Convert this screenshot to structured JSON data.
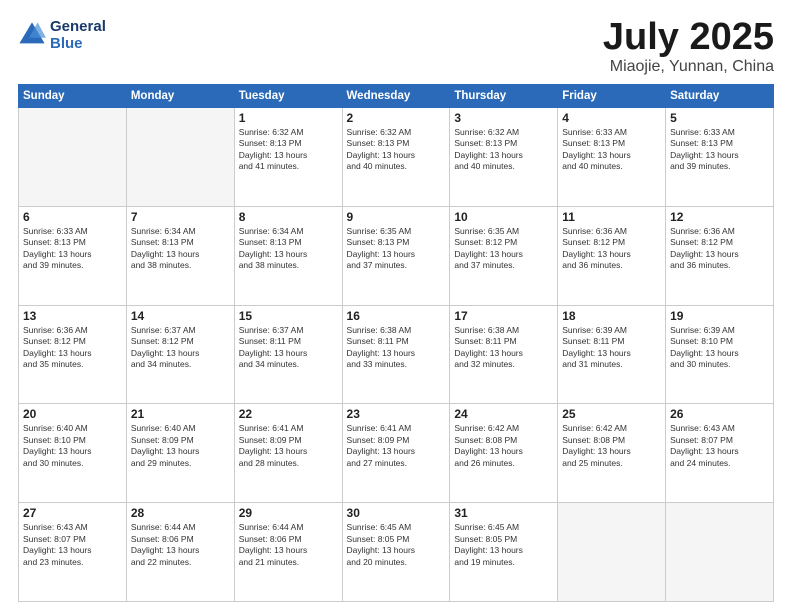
{
  "logo": {
    "line1": "General",
    "line2": "Blue"
  },
  "header": {
    "month": "July 2025",
    "location": "Miaojie, Yunnan, China"
  },
  "weekdays": [
    "Sunday",
    "Monday",
    "Tuesday",
    "Wednesday",
    "Thursday",
    "Friday",
    "Saturday"
  ],
  "weeks": [
    [
      {
        "day": "",
        "text": ""
      },
      {
        "day": "",
        "text": ""
      },
      {
        "day": "1",
        "text": "Sunrise: 6:32 AM\nSunset: 8:13 PM\nDaylight: 13 hours\nand 41 minutes."
      },
      {
        "day": "2",
        "text": "Sunrise: 6:32 AM\nSunset: 8:13 PM\nDaylight: 13 hours\nand 40 minutes."
      },
      {
        "day": "3",
        "text": "Sunrise: 6:32 AM\nSunset: 8:13 PM\nDaylight: 13 hours\nand 40 minutes."
      },
      {
        "day": "4",
        "text": "Sunrise: 6:33 AM\nSunset: 8:13 PM\nDaylight: 13 hours\nand 40 minutes."
      },
      {
        "day": "5",
        "text": "Sunrise: 6:33 AM\nSunset: 8:13 PM\nDaylight: 13 hours\nand 39 minutes."
      }
    ],
    [
      {
        "day": "6",
        "text": "Sunrise: 6:33 AM\nSunset: 8:13 PM\nDaylight: 13 hours\nand 39 minutes."
      },
      {
        "day": "7",
        "text": "Sunrise: 6:34 AM\nSunset: 8:13 PM\nDaylight: 13 hours\nand 38 minutes."
      },
      {
        "day": "8",
        "text": "Sunrise: 6:34 AM\nSunset: 8:13 PM\nDaylight: 13 hours\nand 38 minutes."
      },
      {
        "day": "9",
        "text": "Sunrise: 6:35 AM\nSunset: 8:13 PM\nDaylight: 13 hours\nand 37 minutes."
      },
      {
        "day": "10",
        "text": "Sunrise: 6:35 AM\nSunset: 8:12 PM\nDaylight: 13 hours\nand 37 minutes."
      },
      {
        "day": "11",
        "text": "Sunrise: 6:36 AM\nSunset: 8:12 PM\nDaylight: 13 hours\nand 36 minutes."
      },
      {
        "day": "12",
        "text": "Sunrise: 6:36 AM\nSunset: 8:12 PM\nDaylight: 13 hours\nand 36 minutes."
      }
    ],
    [
      {
        "day": "13",
        "text": "Sunrise: 6:36 AM\nSunset: 8:12 PM\nDaylight: 13 hours\nand 35 minutes."
      },
      {
        "day": "14",
        "text": "Sunrise: 6:37 AM\nSunset: 8:12 PM\nDaylight: 13 hours\nand 34 minutes."
      },
      {
        "day": "15",
        "text": "Sunrise: 6:37 AM\nSunset: 8:11 PM\nDaylight: 13 hours\nand 34 minutes."
      },
      {
        "day": "16",
        "text": "Sunrise: 6:38 AM\nSunset: 8:11 PM\nDaylight: 13 hours\nand 33 minutes."
      },
      {
        "day": "17",
        "text": "Sunrise: 6:38 AM\nSunset: 8:11 PM\nDaylight: 13 hours\nand 32 minutes."
      },
      {
        "day": "18",
        "text": "Sunrise: 6:39 AM\nSunset: 8:11 PM\nDaylight: 13 hours\nand 31 minutes."
      },
      {
        "day": "19",
        "text": "Sunrise: 6:39 AM\nSunset: 8:10 PM\nDaylight: 13 hours\nand 30 minutes."
      }
    ],
    [
      {
        "day": "20",
        "text": "Sunrise: 6:40 AM\nSunset: 8:10 PM\nDaylight: 13 hours\nand 30 minutes."
      },
      {
        "day": "21",
        "text": "Sunrise: 6:40 AM\nSunset: 8:09 PM\nDaylight: 13 hours\nand 29 minutes."
      },
      {
        "day": "22",
        "text": "Sunrise: 6:41 AM\nSunset: 8:09 PM\nDaylight: 13 hours\nand 28 minutes."
      },
      {
        "day": "23",
        "text": "Sunrise: 6:41 AM\nSunset: 8:09 PM\nDaylight: 13 hours\nand 27 minutes."
      },
      {
        "day": "24",
        "text": "Sunrise: 6:42 AM\nSunset: 8:08 PM\nDaylight: 13 hours\nand 26 minutes."
      },
      {
        "day": "25",
        "text": "Sunrise: 6:42 AM\nSunset: 8:08 PM\nDaylight: 13 hours\nand 25 minutes."
      },
      {
        "day": "26",
        "text": "Sunrise: 6:43 AM\nSunset: 8:07 PM\nDaylight: 13 hours\nand 24 minutes."
      }
    ],
    [
      {
        "day": "27",
        "text": "Sunrise: 6:43 AM\nSunset: 8:07 PM\nDaylight: 13 hours\nand 23 minutes."
      },
      {
        "day": "28",
        "text": "Sunrise: 6:44 AM\nSunset: 8:06 PM\nDaylight: 13 hours\nand 22 minutes."
      },
      {
        "day": "29",
        "text": "Sunrise: 6:44 AM\nSunset: 8:06 PM\nDaylight: 13 hours\nand 21 minutes."
      },
      {
        "day": "30",
        "text": "Sunrise: 6:45 AM\nSunset: 8:05 PM\nDaylight: 13 hours\nand 20 minutes."
      },
      {
        "day": "31",
        "text": "Sunrise: 6:45 AM\nSunset: 8:05 PM\nDaylight: 13 hours\nand 19 minutes."
      },
      {
        "day": "",
        "text": ""
      },
      {
        "day": "",
        "text": ""
      }
    ]
  ]
}
